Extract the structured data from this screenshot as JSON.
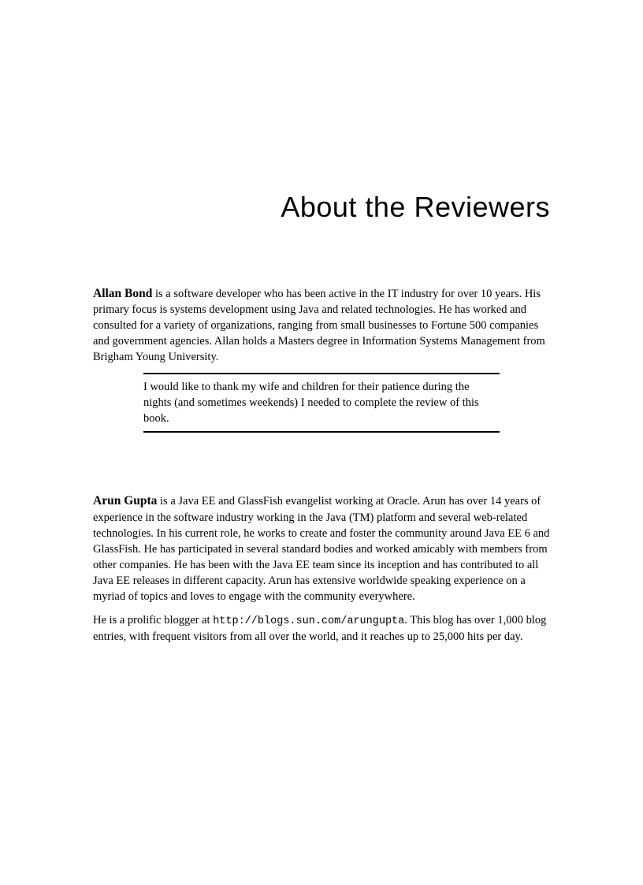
{
  "title": "About the Reviewers",
  "reviewers": [
    {
      "name": "Allan Bond",
      "bio_after_name": " is a software developer who has been active in the IT industry for over 10 years. His primary focus is systems development using Java and related technologies. He has worked and consulted for a variety of organizations, ranging from small businesses to Fortune 500 companies and government agencies. Allan holds a Masters degree in Information Systems Management from Brigham Young University.",
      "quote": "I would like to thank my wife and children for their patience during the nights (and sometimes weekends) I needed to complete the review of this book."
    },
    {
      "name": "Arun Gupta",
      "bio_after_name": " is a Java EE and GlassFish evangelist working at Oracle. Arun has over 14 years of experience in the software industry working in the Java (TM) platform and several web-related technologies. In his current role, he works to create and foster the community around Java EE 6 and GlassFish. He has participated in several standard bodies and worked amicably with members from other companies. He has been with the Java EE team since its inception and has contributed to all Java EE releases in different capacity. Arun has extensive worldwide speaking experience on a myriad of topics and loves to engage with the community everywhere.",
      "extra_before_url": "He is a prolific blogger at ",
      "url": "http://blogs.sun.com/arungupta",
      "extra_after_url": ". This blog has over 1,000 blog entries, with frequent visitors from all over the world, and it reaches up to 25,000 hits per day."
    }
  ]
}
